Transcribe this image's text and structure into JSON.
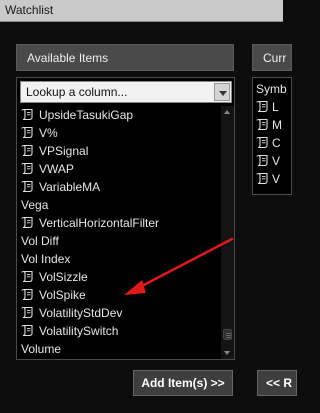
{
  "window": {
    "title": "Watchlist"
  },
  "available": {
    "header": "Available Items",
    "lookup_placeholder": "Lookup a column...",
    "items": [
      {
        "label": "UpsideTasukiGap",
        "has_icon": true
      },
      {
        "label": "V%",
        "has_icon": true
      },
      {
        "label": "VPSignal",
        "has_icon": true
      },
      {
        "label": "VWAP",
        "has_icon": true
      },
      {
        "label": "VariableMA",
        "has_icon": true
      },
      {
        "label": "Vega",
        "has_icon": false
      },
      {
        "label": "VerticalHorizontalFilter",
        "has_icon": true
      },
      {
        "label": "Vol Diff",
        "has_icon": false
      },
      {
        "label": "Vol Index",
        "has_icon": false
      },
      {
        "label": "VolSizzle",
        "has_icon": true
      },
      {
        "label": "VolSpike",
        "has_icon": true
      },
      {
        "label": "VolatilityStdDev",
        "has_icon": true
      },
      {
        "label": "VolatilitySwitch",
        "has_icon": true
      },
      {
        "label": "Volume",
        "has_icon": false
      }
    ],
    "scroll_position": 0.97
  },
  "current": {
    "header": "Curr",
    "items": [
      {
        "label": "Symb",
        "has_icon": false
      },
      {
        "label": "L",
        "has_icon": true
      },
      {
        "label": "M",
        "has_icon": true
      },
      {
        "label": "C",
        "has_icon": true
      },
      {
        "label": "V",
        "has_icon": true
      },
      {
        "label": "V",
        "has_icon": true
      }
    ]
  },
  "buttons": {
    "add": "Add Item(s) >>",
    "remove": "<< R"
  },
  "annotation": {
    "color": "#e0191b",
    "points_to": "VolSpike"
  },
  "icons": {
    "study": "study-script-icon"
  },
  "colors": {
    "background": "#0d0d0d",
    "panel_header": "#4a4a4a",
    "list_bg": "#000000",
    "text": "#e6e6e6"
  }
}
